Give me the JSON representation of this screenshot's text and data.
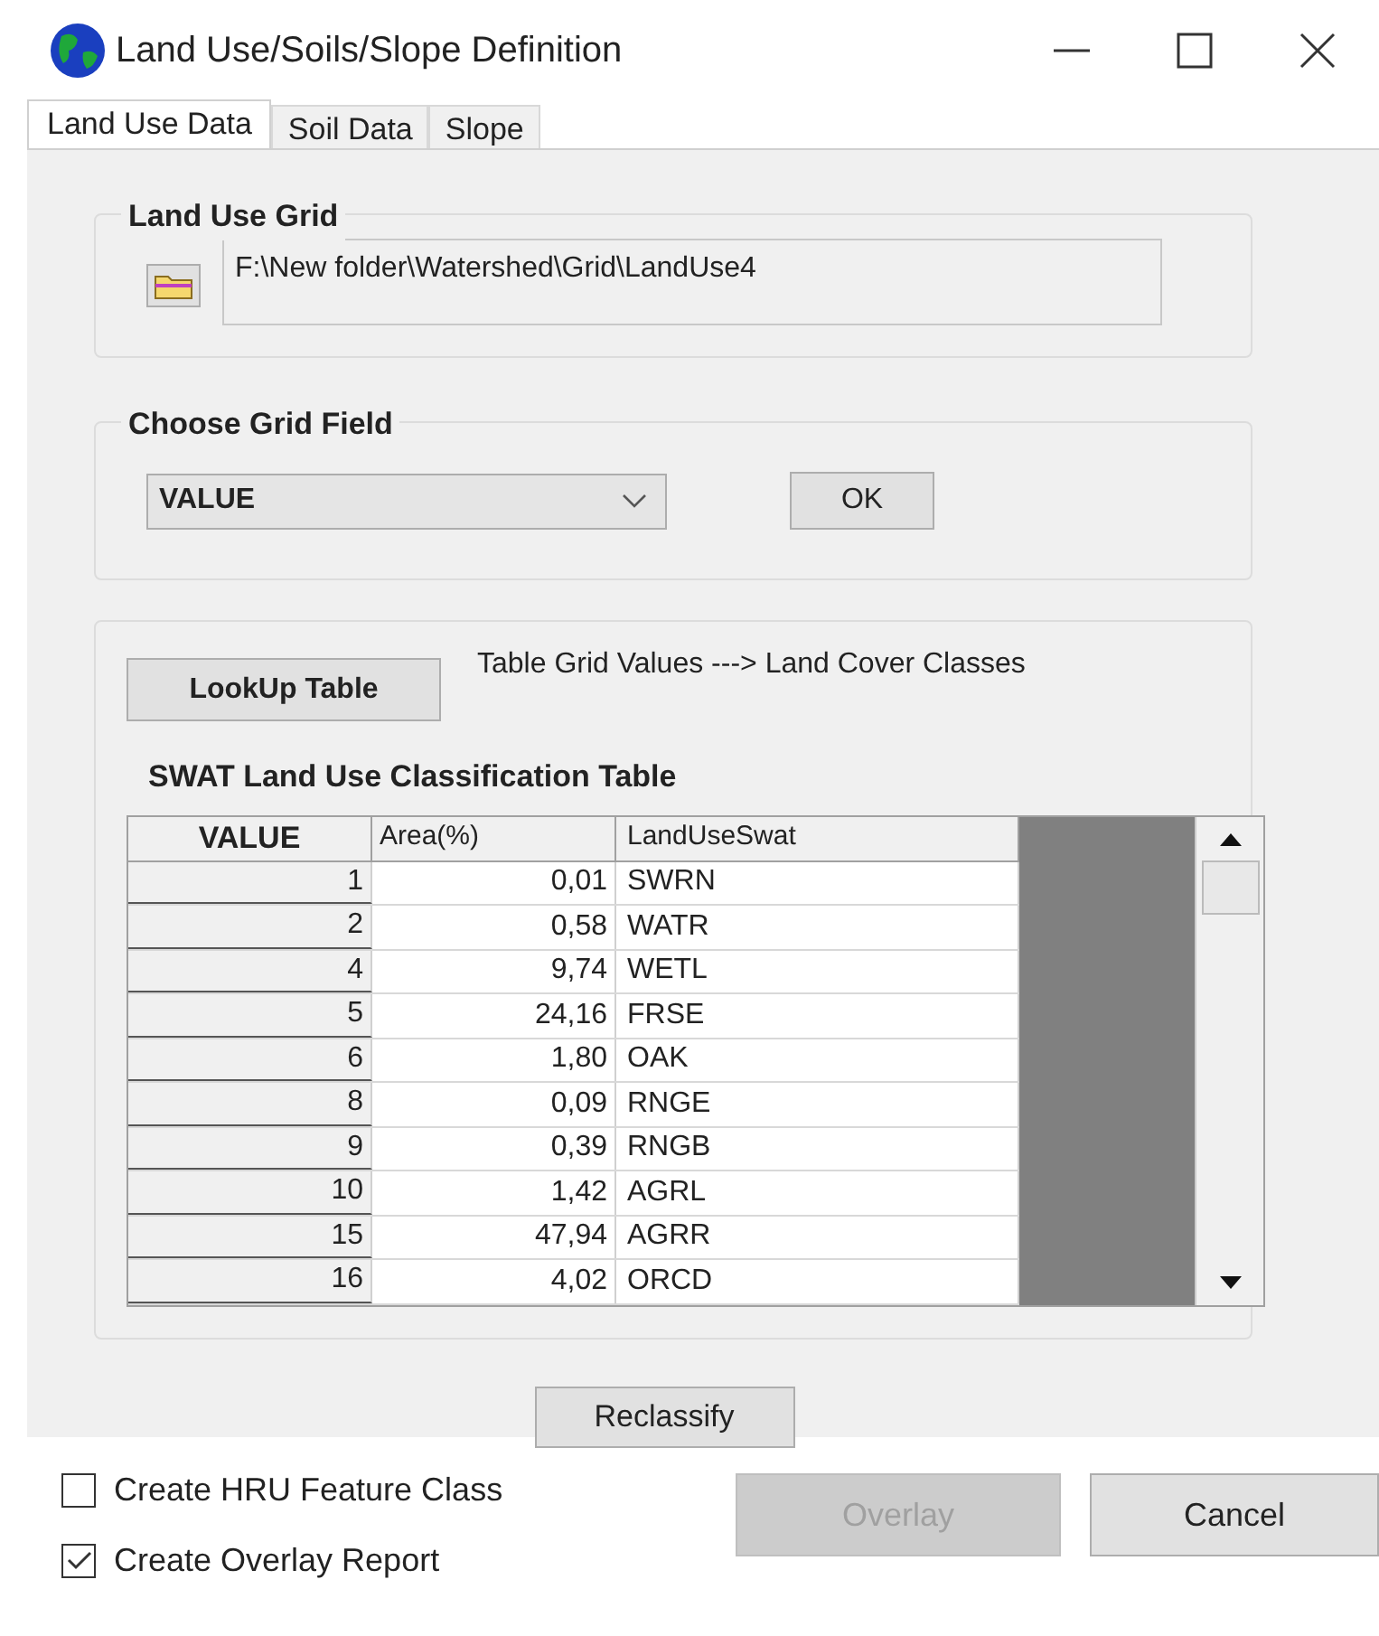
{
  "window": {
    "title": "Land Use/Soils/Slope Definition"
  },
  "tabs": [
    {
      "label": "Land Use Data",
      "selected": true
    },
    {
      "label": "Soil Data",
      "selected": false
    },
    {
      "label": "Slope",
      "selected": false
    }
  ],
  "land_use_grid": {
    "title": "Land Use Grid",
    "path": "F:\\New folder\\Watershed\\Grid\\LandUse4"
  },
  "choose_grid_field": {
    "title": "Choose Grid Field",
    "value": "VALUE",
    "ok_button": "OK"
  },
  "lookup": {
    "button": "LookUp Table",
    "description": "Table Grid Values ---> Land Cover Classes"
  },
  "table": {
    "title": "SWAT Land Use Classification Table",
    "columns": [
      "VALUE",
      "Area(%)",
      "LandUseSwat"
    ],
    "rows": [
      [
        "1",
        "0,01",
        "SWRN"
      ],
      [
        "2",
        "0,58",
        "WATR"
      ],
      [
        "4",
        "9,74",
        "WETL"
      ],
      [
        "5",
        "24,16",
        "FRSE"
      ],
      [
        "6",
        "1,80",
        "OAK"
      ],
      [
        "8",
        "0,09",
        "RNGE"
      ],
      [
        "9",
        "0,39",
        "RNGB"
      ],
      [
        "10",
        "1,42",
        "AGRL"
      ],
      [
        "15",
        "47,94",
        "AGRR"
      ],
      [
        "16",
        "4,02",
        "ORCD"
      ]
    ]
  },
  "reclassify_button": "Reclassify",
  "options": [
    {
      "label": "Create HRU Feature Class",
      "checked": false
    },
    {
      "label": "Create Overlay Report",
      "checked": true
    }
  ],
  "buttons": [
    {
      "label": "Overlay",
      "disabled": true
    },
    {
      "label": "Cancel",
      "disabled": false
    }
  ]
}
